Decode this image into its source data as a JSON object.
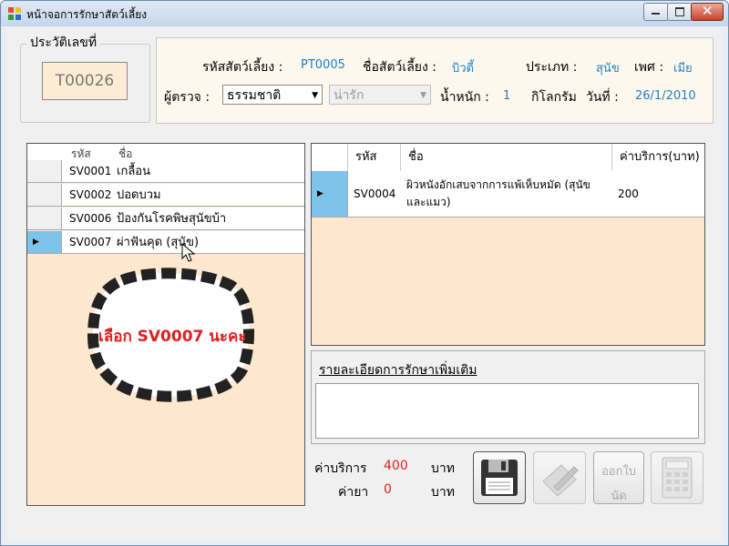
{
  "window": {
    "title": "หน้าจอการรักษาสัตว์เลี้ยง"
  },
  "history": {
    "label": "ประวัติเลขที่",
    "value": "T00026"
  },
  "pet": {
    "id_label": "รหัสสัตว์เลี้ยง :",
    "id_value": "PT0005",
    "name_label": "ชื่อสัตว์เลี้ยง :",
    "name_value": "บิวตี้",
    "type_label": "ประเภท :",
    "type_value": "สุนัข",
    "sex_label": "เพศ :",
    "sex_value": "เมีย",
    "examiner_label": "ผู้ตรวจ :",
    "examiner_value": "ธรรมชาติ",
    "combo2_value": "น่ารัก",
    "weight_label": "น้ำหนัก :",
    "weight_value": "1",
    "weight_unit": "กิโลกรัม",
    "date_label": "วันที่ :",
    "date_value": "26/1/2010"
  },
  "services": {
    "columns": [
      "รหัส",
      "ชื่อ"
    ],
    "rows": [
      {
        "code": "SV0001",
        "name": "เกลื้อน"
      },
      {
        "code": "SV0002",
        "name": "ปอดบวม"
      },
      {
        "code": "SV0006",
        "name": "ป้องกันโรคพิษสุนัขบ้า"
      },
      {
        "code": "SV0007",
        "name": "ผ่าฟันคุด (สุนัข)"
      }
    ]
  },
  "annotation": {
    "text": "เลือก SV0007 นะคะ"
  },
  "selected": {
    "columns": [
      "รหัส",
      "ชื่อ",
      "ค่าบริการ(บาท)"
    ],
    "rows": [
      {
        "code": "SV0004",
        "name1": "ผิวหนังอักเสบจากการแพ้เห็บหมัด (สุนัข",
        "name2": "และแมว)",
        "price": "200"
      }
    ]
  },
  "details": {
    "label": "รายละเอียดการรักษาเพิ่มเติม",
    "value": ""
  },
  "cost": {
    "service_label": "ค่าบริการ",
    "service_value": "400",
    "service_unit": "บาท",
    "drug_label": "ค่ายา",
    "drug_value": "0",
    "drug_unit": "บาท"
  },
  "buttons": {
    "appointment_line1": "ออกใบ",
    "appointment_line2": "นัด"
  },
  "colors": {
    "accent": "#1e80c8",
    "panel": "#fde8cf",
    "cost": "#e02020",
    "annotation": "#e02020"
  }
}
